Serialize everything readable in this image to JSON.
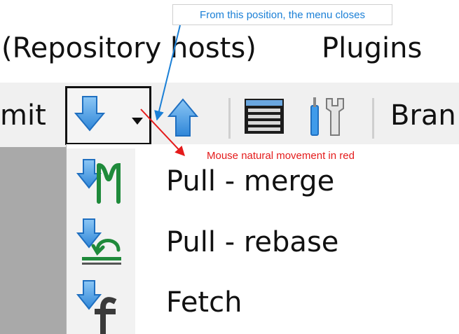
{
  "menubar": {
    "items": [
      {
        "label": "(Repository hosts)"
      },
      {
        "label": "Plugins"
      }
    ]
  },
  "toolbar": {
    "commit_partial": "mit",
    "branch_partial": "Bran",
    "buttons": [
      {
        "icon": "pull-arrow-down-icon"
      },
      {
        "icon": "dropdown-caret-icon"
      },
      {
        "icon": "push-arrow-up-icon"
      },
      {
        "icon": "stash-icon"
      },
      {
        "icon": "settings-tools-icon"
      }
    ]
  },
  "dropdown": {
    "items": [
      {
        "label": "Pull - merge",
        "icon": "pull-merge-icon"
      },
      {
        "label": "Pull - rebase",
        "icon": "pull-rebase-icon"
      },
      {
        "label": "Fetch",
        "icon": "fetch-icon"
      }
    ]
  },
  "annotations": {
    "blue": {
      "text": "From this position, the menu closes",
      "color": "#1a7fd6"
    },
    "red": {
      "text": "Mouse natural movement in red",
      "color": "#e41b1b"
    }
  },
  "colors": {
    "icon_blue": "#3f9bea",
    "icon_blue_dark": "#1f6fc0",
    "icon_green": "#1f8a3b",
    "toolbar_bg": "#f0f0f0",
    "menu_gray": "#a9a9a9"
  }
}
